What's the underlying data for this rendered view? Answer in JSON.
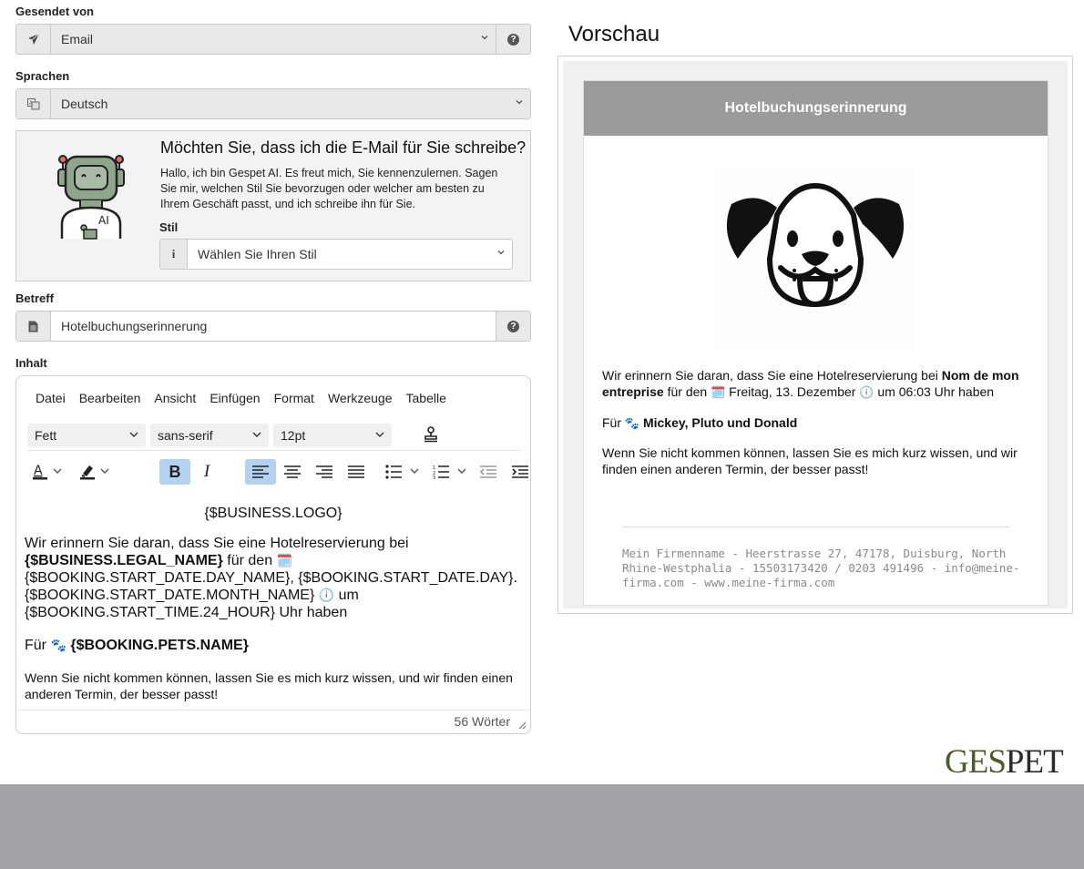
{
  "sent_via": {
    "label": "Gesendet von",
    "value": "Email"
  },
  "languages": {
    "label": "Sprachen",
    "value": "Deutsch"
  },
  "ai_assistant": {
    "title": "Möchten Sie, dass ich die E-Mail für Sie schreibe?",
    "text": "Hallo, ich bin Gespet AI. Es freut mich, Sie kennenzulernen. Sagen Sie mir, welchen Stil Sie bevorzugen oder welcher am besten zu Ihrem Geschäft passt, und ich schreibe ihn für Sie.",
    "style_label": "Stil",
    "style_value": "Wählen Sie Ihren Stil",
    "robot_badge": "AI"
  },
  "subject": {
    "label": "Betreff",
    "value": "Hotelbuchungserinnerung"
  },
  "content": {
    "label": "Inhalt",
    "menu": [
      "Datei",
      "Bearbeiten",
      "Ansicht",
      "Einfügen",
      "Format",
      "Werkzeuge",
      "Tabelle"
    ],
    "block_format": "Fett",
    "font_family": "sans-serif",
    "font_size": "12pt",
    "body": {
      "logo": "{$BUSINESS.LOGO}",
      "p1_a": "Wir erinnern Sie daran, dass Sie eine Hotelreservierung bei",
      "p1_bold": "{$BUSINESS.LEGAL_NAME}",
      "p1_b": "für den",
      "p1_emoji1": "🗓️",
      "p1_c": "{$BOOKING.START_DATE.DAY_NAME}, {$BOOKING.START_DATE.DAY}.",
      "p1_d": "{$BOOKING.START_DATE.MONTH_NAME}",
      "p1_emoji2": "🕕",
      "p1_e": "um",
      "p1_f": "{$BOOKING.START_TIME.24_HOUR} Uhr haben",
      "p2_a": "Für",
      "p2_emoji": "🐾",
      "p2_bold": "{$BOOKING.PETS.NAME}",
      "p3": "Wenn Sie nicht kommen können, lassen Sie es mich kurz wissen, und wir finden einen anderen Termin, der besser passt!"
    },
    "word_count": "56 Wörter"
  },
  "preview": {
    "title": "Vorschau",
    "header": "Hotelbuchungserinnerung",
    "p1_a": "Wir erinnern Sie daran, dass Sie eine Hotelreservierung bei",
    "p1_bold": "Nom de mon entreprise",
    "p1_b": "für den",
    "p1_emoji1": "🗓️",
    "p1_c": "Freitag, 13. Dezember",
    "p1_emoji2": "🕕",
    "p1_d": "um 06:03 Uhr haben",
    "p2_a": "Für",
    "p2_emoji": "🐾",
    "p2_bold": "Mickey, Pluto und Donald",
    "p3": "Wenn Sie nicht kommen können, lassen Sie es mich kurz wissen, und wir finden einen anderen Termin, der besser passt!",
    "footer": "Mein Firmenname - Heerstrasse 27, 47178, Duisburg, North Rhine-Westphalia - 15503173420 / 0203 491496 - info@meine-firma.com - www.meine-firma.com"
  },
  "brand": {
    "part1": "GES",
    "part2": "PET"
  },
  "colors": {
    "brand_green": "#4e5a2a",
    "preview_header": "#9b9b9b",
    "active_button": "#b3d1f0",
    "footer_band": "#a3a3a5"
  },
  "icons": [
    "paper-plane-icon",
    "question-icon",
    "language-icon",
    "info-icon",
    "document-icon",
    "stamp-icon",
    "bold-icon",
    "italic-icon",
    "align-left-icon",
    "align-center-icon",
    "align-right-icon",
    "align-justify-icon",
    "bullet-list-icon",
    "numbered-list-icon",
    "outdent-icon",
    "indent-icon",
    "text-color-icon",
    "highlight-icon",
    "resize-handle-icon"
  ]
}
